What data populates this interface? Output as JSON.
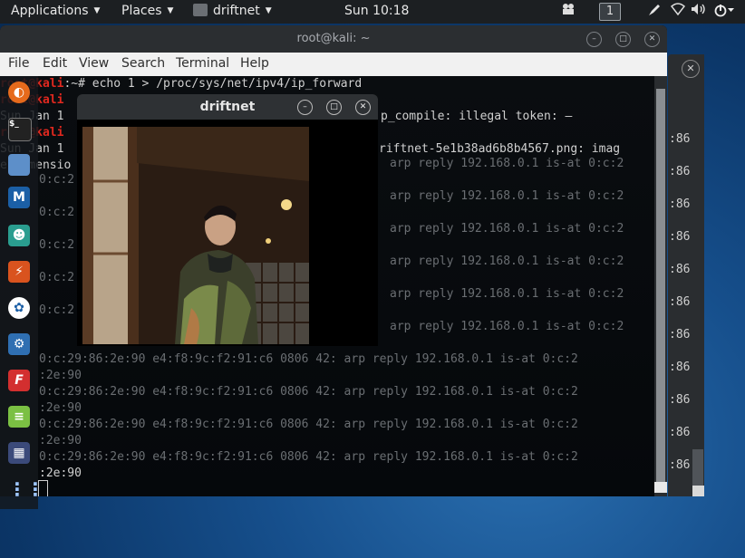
{
  "topbar": {
    "applications": "Applications",
    "places": "Places",
    "active_app": "driftnet",
    "clock": "Sun 10:18",
    "workspace": "1",
    "icons": [
      "video-icon",
      "pen-icon",
      "wifi-icon",
      "volume-icon",
      "power-icon"
    ]
  },
  "terminal": {
    "title": "root@kali: ~",
    "menu": [
      "File",
      "Edit",
      "View",
      "Search",
      "Terminal",
      "Help"
    ],
    "prompt_user": "root@kali",
    "prompt_rest": ":~# ",
    "command": "echo 1 > /proc/sys/net/ipv4/ip_forward",
    "lines": [
      {
        "left": "Sun Jan 1",
        "right": "p_compile: illegal token: —"
      },
      {
        "left": "root@kali",
        "right": ""
      },
      {
        "left": "Sun Jan 1",
        "right": "riftnet-5e1b38ad6b8b4567.png: imag"
      },
      {
        "left": "e dimensio",
        "right": ""
      }
    ],
    "arp_text": "arp reply 192.168.0.1 is-at 0:c:2",
    "arp_tail": ":86",
    "left_frag": "0:c:2",
    "full_line": "0:c:29:86:2e:90 e4:f8:9c:f2:91:c6 0806 42: arp reply 192.168.0.1 is-at 0:c:2",
    "cont_line": ":2e:90"
  },
  "driftnet": {
    "title": "driftnet",
    "image_alt": "captured photo of a man in a patterned jacket standing in a wooden doorway"
  },
  "dock": {
    "items": [
      "firefox-icon",
      "terminal-icon",
      "files-icon",
      "metasploit-icon",
      "armitage-icon",
      "burpsuite-icon",
      "maltego-icon",
      "beef-icon",
      "faraday-icon",
      "leafpad-icon",
      "cherrytree-icon",
      "app-grid-icon"
    ]
  },
  "colors": {
    "prompt_red": "#e0281f",
    "terminal_bg": "#05080b",
    "panel_bg": "#1c1f22",
    "menu_bg": "#f1f1f1"
  }
}
